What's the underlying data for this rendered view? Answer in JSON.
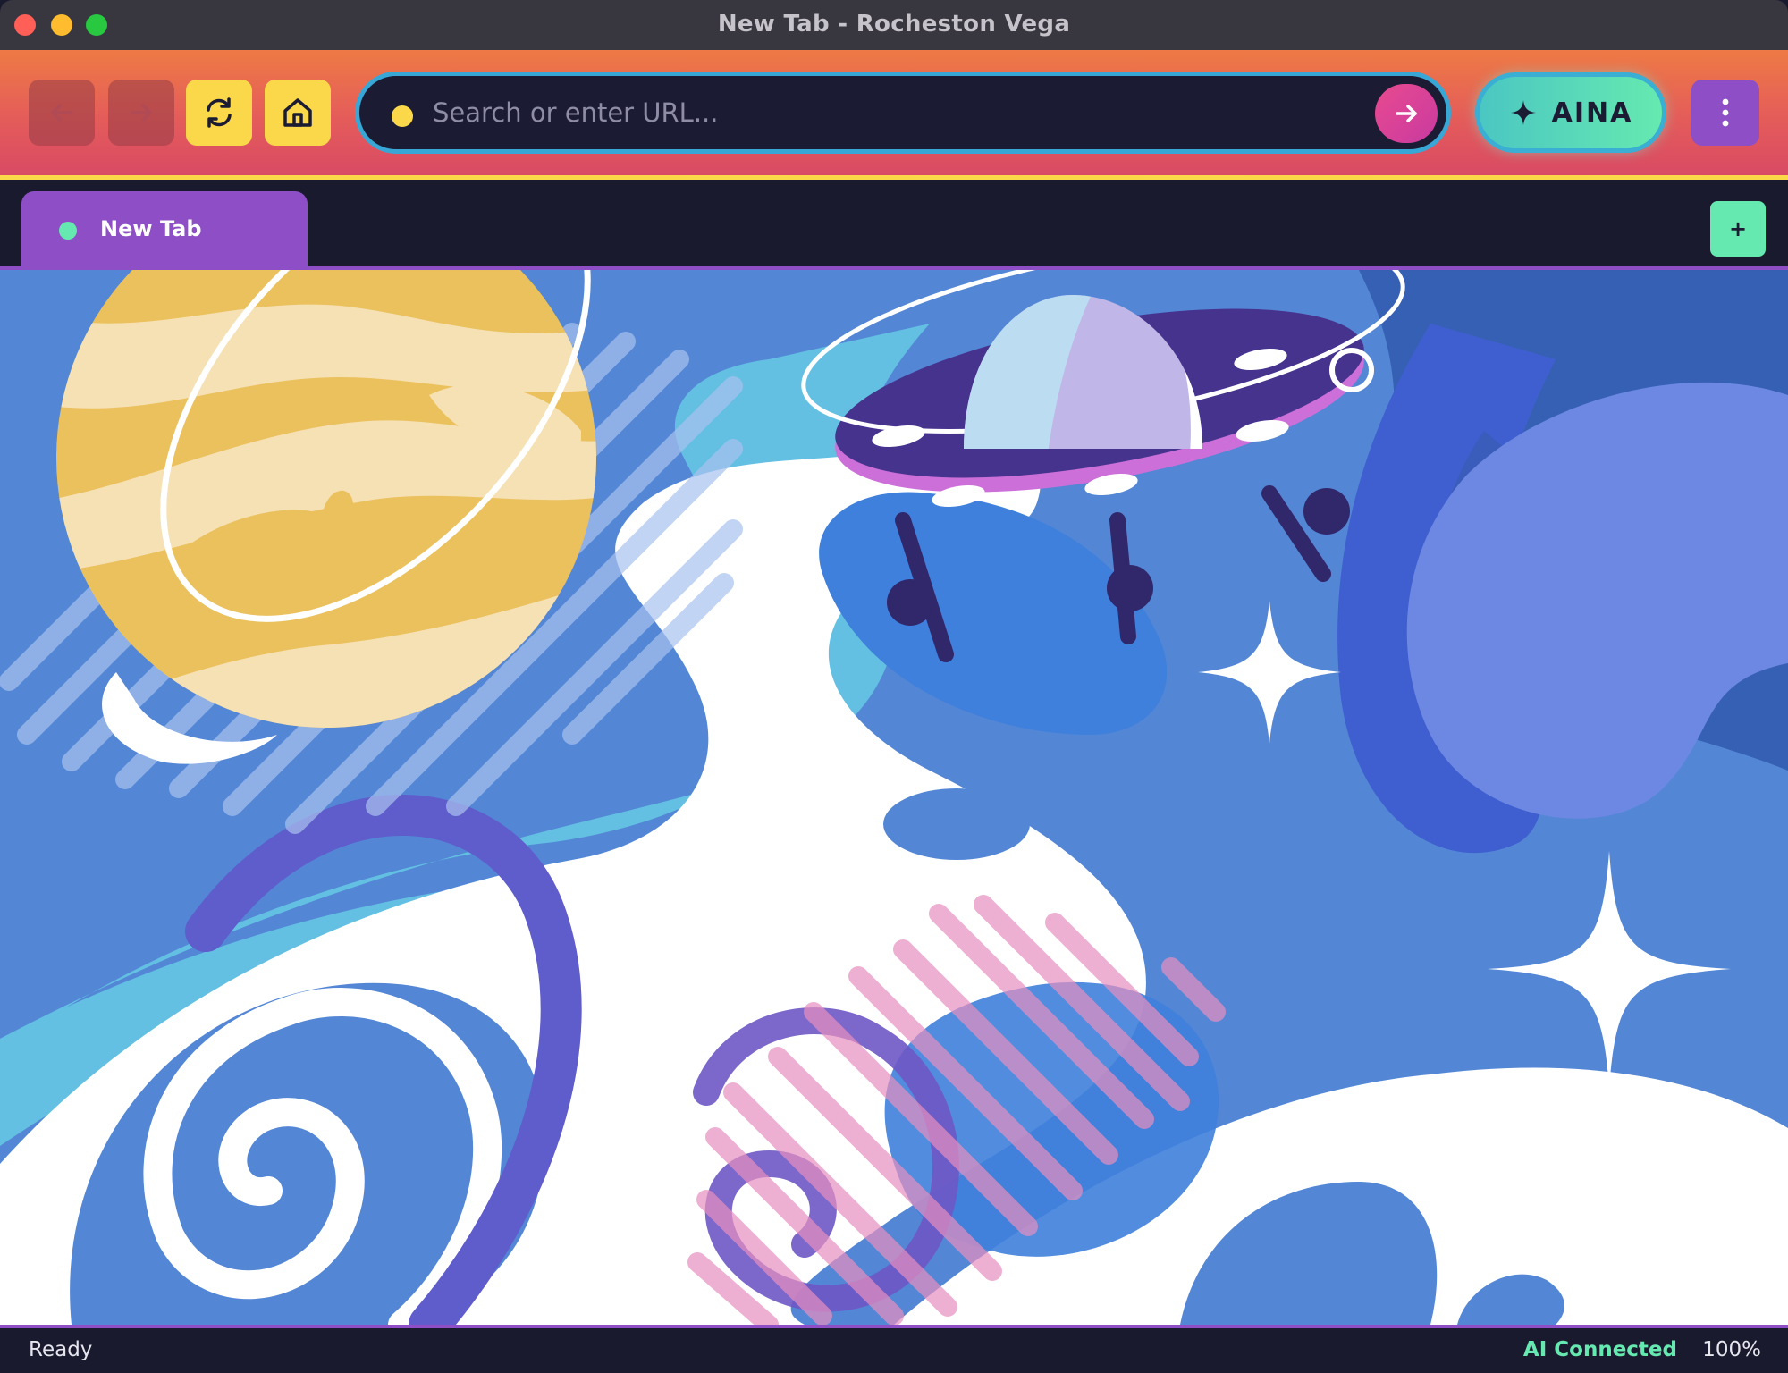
{
  "window": {
    "title": "New Tab - Rocheston Vega"
  },
  "toolbar": {
    "back_icon": "arrow-left-icon",
    "forward_icon": "arrow-right-icon",
    "reload_icon": "reload-icon",
    "home_icon": "home-icon",
    "url_placeholder": "Search or enter URL...",
    "url_value": "",
    "go_icon": "arrow-right-icon",
    "ai_button_label": "AINA",
    "ai_icon": "sparkle-icon",
    "menu_icon": "kebab-menu-icon"
  },
  "tabs": [
    {
      "label": "New Tab",
      "active": true,
      "indicator_color": "#66e9b0"
    }
  ],
  "new_tab_label": "+",
  "content": {
    "type": "space-illustration"
  },
  "status": {
    "left": "Ready",
    "ai_status": "AI Connected",
    "zoom": "100%"
  },
  "colors": {
    "accent_purple": "#8e4ec6",
    "accent_yellow": "#fbd84a",
    "accent_mint": "#66e9b0",
    "accent_pink": "#e84a8f",
    "dark_bg": "#1a1a2e"
  }
}
